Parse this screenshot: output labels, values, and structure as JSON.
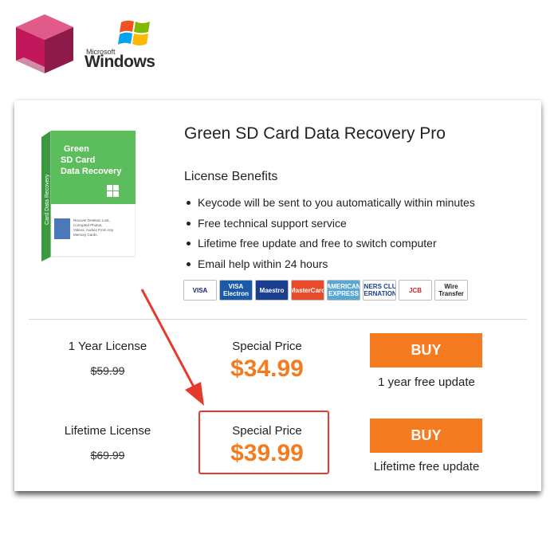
{
  "branding": {
    "os_small": "Microsoft",
    "os_word": "Windows"
  },
  "product": {
    "title": "Green SD Card Data Recovery Pro",
    "box_lines": [
      "Green",
      "SD Card",
      "Data Recovery"
    ],
    "box_spine": "Card Data Recovery",
    "box_desc": [
      "Recover Deleted, Lost,",
      "Corrupted Photos,",
      "Videos, Audios From Any",
      "Memory Cards."
    ]
  },
  "benefits": {
    "heading": "License Benefits",
    "items": [
      "Keycode will be sent to you automatically within minutes",
      "Free technical support service",
      "Lifetime free update and free to switch computer",
      "Email help within 24 hours"
    ]
  },
  "payments": [
    {
      "label": "VISA",
      "bg": "#ffffff",
      "fg": "#1a1f71"
    },
    {
      "label": "VISA Electron",
      "bg": "#1a5aa8",
      "fg": "#ffffff"
    },
    {
      "label": "Maestro",
      "bg": "#1b3f8f",
      "fg": "#ffffff"
    },
    {
      "label": "MasterCard",
      "bg": "#e84a2c",
      "fg": "#ffffff"
    },
    {
      "label": "AMERICAN EXPRESS",
      "bg": "#5aa7d6",
      "fg": "#ffffff"
    },
    {
      "label": "DINERS CLUB INTERNATIONAL",
      "bg": "#ffffff",
      "fg": "#1b3f8f"
    },
    {
      "label": "JCB",
      "bg": "#ffffff",
      "fg": "#d32027"
    },
    {
      "label": "Wire Transfer",
      "bg": "#ffffff",
      "fg": "#222222"
    }
  ],
  "licenses": [
    {
      "name": "1 Year License",
      "old_price": "$59.99",
      "special_label": "Special Price",
      "price": "$34.99",
      "buy_label": "BUY",
      "note": "1 year free update"
    },
    {
      "name": "Lifetime License",
      "old_price": "$69.99",
      "special_label": "Special Price",
      "price": "$39.99",
      "buy_label": "BUY",
      "note": "Lifetime free update"
    }
  ],
  "colors": {
    "accent": "#f47b20",
    "highlight": "#e63a2e",
    "box_green": "#4caf50"
  }
}
